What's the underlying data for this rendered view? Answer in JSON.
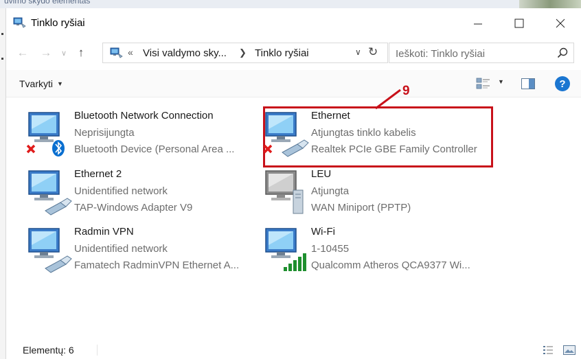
{
  "background_window": {
    "text": "uvimo skydo elementas"
  },
  "window": {
    "title": "Tinklo ryšiai"
  },
  "address_bar": {
    "overflow_marker": "«",
    "path": [
      "Visi valdymo sky...",
      "Tinklo ryšiai"
    ]
  },
  "search": {
    "placeholder": "Ieškoti: Tinklo ryšiai"
  },
  "command_bar": {
    "organize_label": "Tvarkyti"
  },
  "annotation": {
    "number": "9",
    "color": "#c8111a"
  },
  "items": [
    {
      "name": "Bluetooth Network Connection",
      "status": "Neprisijungta",
      "device": "Bluetooth Device (Personal Area ...",
      "icon": "network-disconnected-icon"
    },
    {
      "name": "Ethernet",
      "status": "Atjungtas tinklo kabelis",
      "device": "Realtek PCIe GBE Family Controller",
      "icon": "network-cable-unplugged-icon"
    },
    {
      "name": "Ethernet 2",
      "status": "Unidentified network",
      "device": "TAP-Windows Adapter V9",
      "icon": "network-connected-icon"
    },
    {
      "name": "LEU",
      "status": "Atjungta",
      "device": "WAN Miniport (PPTP)",
      "icon": "vpn-disabled-icon"
    },
    {
      "name": "Radmin VPN",
      "status": "Unidentified network",
      "device": "Famatech RadminVPN Ethernet A...",
      "icon": "network-connected-icon"
    },
    {
      "name": "Wi-Fi",
      "status": "1-10455",
      "device": "Qualcomm Atheros QCA9377 Wi...",
      "icon": "wifi-connected-icon"
    }
  ],
  "status_bar": {
    "item_count": "Elementų: 6"
  },
  "colors": {
    "accent": "#1b76d1",
    "annotation": "#c8111a"
  }
}
